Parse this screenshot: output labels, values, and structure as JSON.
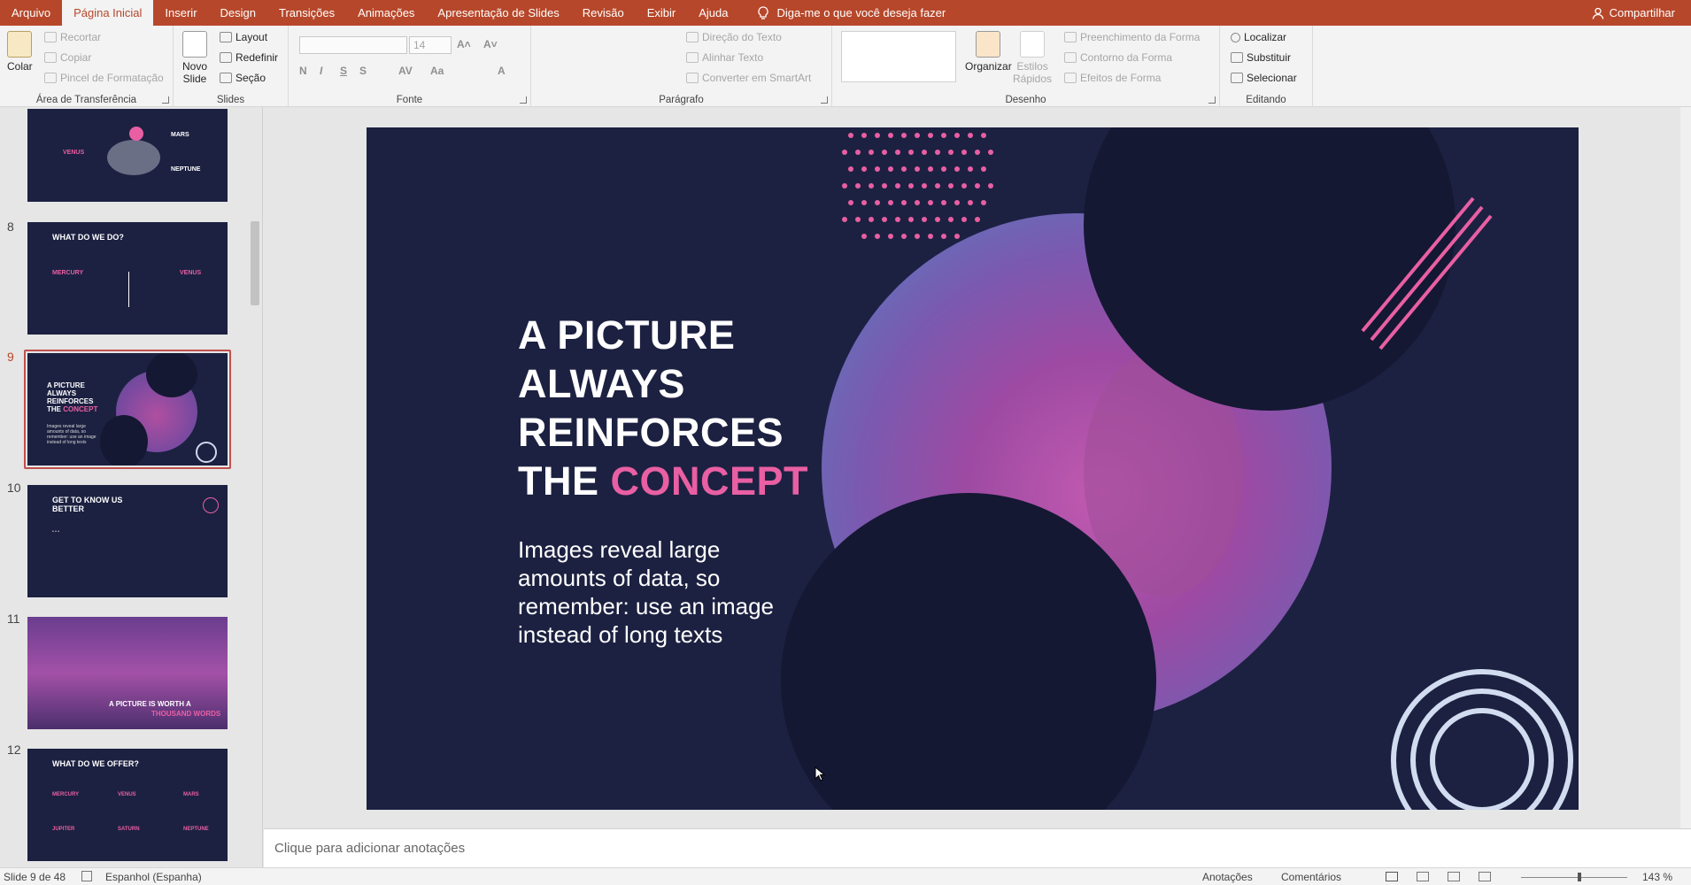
{
  "menu": {
    "tabs": [
      "Arquivo",
      "Página Inicial",
      "Inserir",
      "Design",
      "Transições",
      "Animações",
      "Apresentação de Slides",
      "Revisão",
      "Exibir",
      "Ajuda"
    ],
    "tell_me": "Diga-me o que você deseja fazer",
    "share": "Compartilhar"
  },
  "ribbon": {
    "clipboard": {
      "label": "Área de Transferência",
      "paste": "Colar",
      "cut": "Recortar",
      "copy": "Copiar",
      "format_painter": "Pincel de Formatação"
    },
    "slides": {
      "label": "Slides",
      "new_slide_1": "Novo",
      "new_slide_2": "Slide",
      "layout": "Layout",
      "reset": "Redefinir",
      "section": "Seção"
    },
    "font": {
      "label": "Fonte",
      "size": "14",
      "bold": "N",
      "italic": "I",
      "underline": "S",
      "shadow": "S",
      "spacing": "AV",
      "case": "Aa",
      "font_color": "A"
    },
    "paragraph": {
      "label": "Parágrafo",
      "text_direction": "Direção do Texto",
      "align_text": "Alinhar Texto",
      "smartart": "Converter em SmartArt"
    },
    "drawing": {
      "label": "Desenho",
      "arrange": "Organizar",
      "quick_styles_1": "Estilos",
      "quick_styles_2": "Rápidos",
      "shape_fill": "Preenchimento da Forma",
      "shape_outline": "Contorno da Forma",
      "shape_effects": "Efeitos de Forma"
    },
    "editing": {
      "label": "Editando",
      "find": "Localizar",
      "replace": "Substituir",
      "select": "Selecionar"
    }
  },
  "thumbnails": [
    {
      "num": "",
      "venus": "VENUS",
      "mars": "MARS",
      "neptune": "NEPTUNE"
    },
    {
      "num": "8",
      "title": "WHAT DO WE DO?",
      "left": "MERCURY",
      "right": "VENUS"
    },
    {
      "num": "9",
      "title_1": "A PICTURE\nALWAYS\nREINFORCES\nTHE ",
      "title_pink": "CONCEPT",
      "body": "Images reveal large amounts of data, so remember: use an image instead of long texts"
    },
    {
      "num": "10",
      "title": "GET TO KNOW US\nBETTER"
    },
    {
      "num": "11",
      "title_1": "A PICTURE IS WORTH A",
      "title_pink": "THOUSAND WORDS"
    },
    {
      "num": "12",
      "title": "WHAT DO WE OFFER?",
      "c1": "MERCURY",
      "c2": "VENUS",
      "c3": "MARS",
      "c4": "JUPITER",
      "c5": "SATURN",
      "c6": "NEPTUNE"
    }
  ],
  "slide": {
    "title_line_1": "A PICTURE",
    "title_line_2": "ALWAYS",
    "title_line_3": "REINFORCES",
    "title_line_4_prefix": "THE ",
    "title_line_4_pink": "CONCEPT",
    "body": "Images reveal large amounts of data, so remember: use an image instead of long texts"
  },
  "notes_placeholder": "Clique para adicionar anotações",
  "status": {
    "slide_counter": "Slide 9 de 48",
    "language": "Espanhol (Espanha)",
    "notes": "Anotações",
    "comments": "Comentários",
    "zoom": "143 %"
  },
  "colors": {
    "accent": "#b7472a",
    "slide_bg": "#1c2141",
    "pink": "#e95fa3"
  }
}
